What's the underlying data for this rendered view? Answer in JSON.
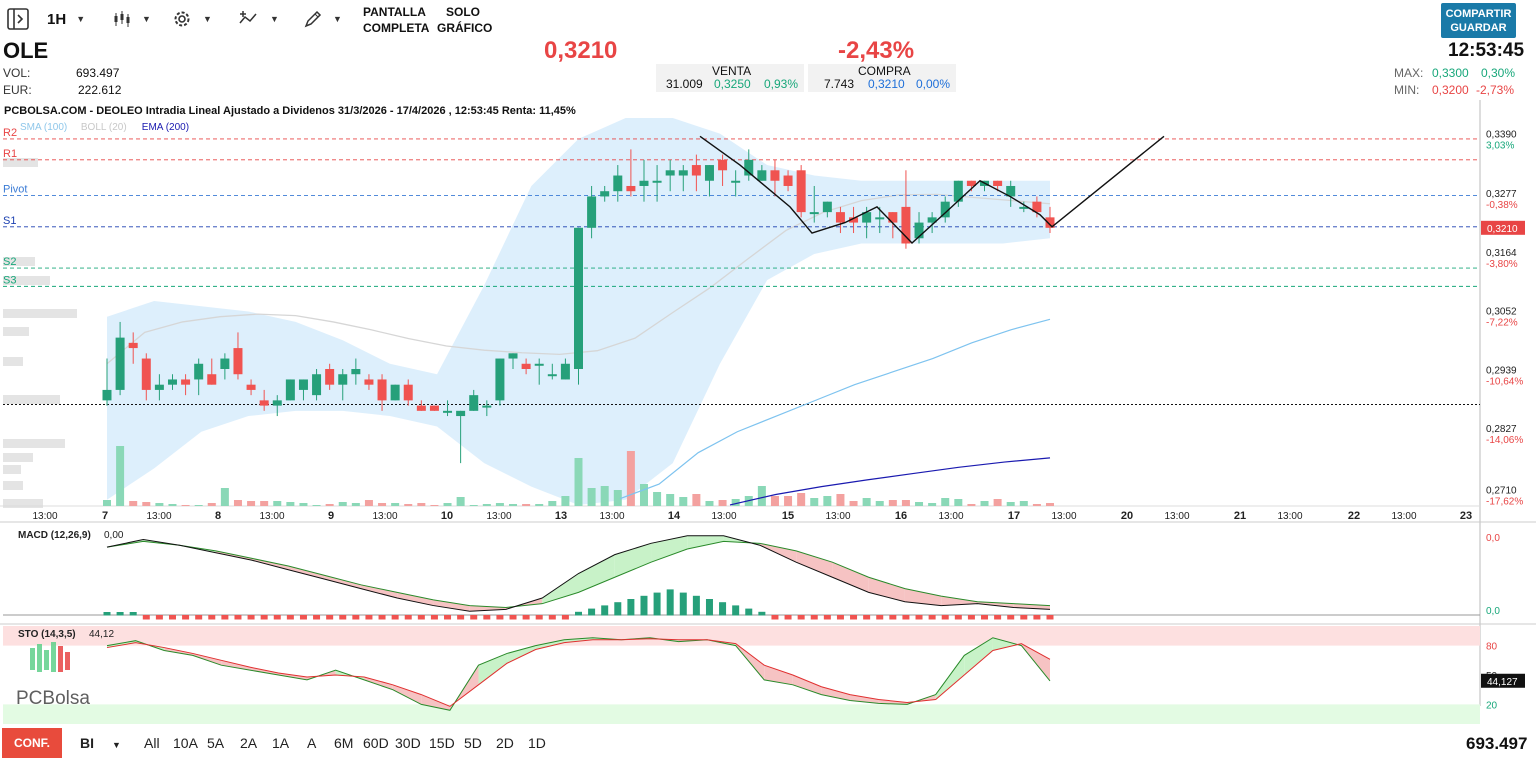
{
  "toolbar": {
    "interval": "1H",
    "fullscreen_line1": "PANTALLA",
    "fullscreen_line2": "COMPLETA",
    "chartonly_line1": "SOLO",
    "chartonly_line2": "GRÁFICO",
    "share_line1": "COMPARTIR",
    "share_line2": "GUARDAR",
    "icons": [
      "panel-toggle-icon",
      "candles-icon",
      "gear-icon",
      "indicators-icon",
      "draw-pencil-icon"
    ]
  },
  "header": {
    "ticker": "OLE",
    "vol_label": "VOL:",
    "vol_value": "693.497",
    "eur_label": "EUR:",
    "eur_value": "222.612",
    "price": "0,3210",
    "change": "-2,43%",
    "time": "12:53:45",
    "sell": {
      "label": "VENTA",
      "qty": "31.009",
      "price": "0,3250",
      "pct": "0,93%"
    },
    "buy": {
      "label": "COMPRA",
      "qty": "7.743",
      "price": "0,3210",
      "pct": "0,00%"
    },
    "max_label": "MAX:",
    "max_price": "0,3300",
    "max_pct": "0,30%",
    "min_label": "MIN:",
    "min_price": "0,3200",
    "min_pct": "-2,73%"
  },
  "colors": {
    "up": "#26a07a",
    "down": "#f05350",
    "accent": "#1a7aa8",
    "price_red": "#e84545"
  },
  "chart_data": [
    {
      "type": "candlestick",
      "title": "PCBOLSA.COM - DEOLEO Intradia Lineal Ajustado a Dividenos 31/3/2026 - 17/4/2026 , 12:53:45 Renta: 11,45%",
      "legend": [
        "SMA (100)",
        "BOLL (20)",
        "EMA (200)"
      ],
      "y_range": [
        0.2678,
        0.342
      ],
      "y_ticks": [
        {
          "value": 0.339,
          "label": "0,3390",
          "pct": "3,03%"
        },
        {
          "value": 0.3277,
          "label": "0,3277",
          "pct": "-0,38%"
        },
        {
          "value": 0.3164,
          "label": "0,3164",
          "pct": "-3,80%"
        },
        {
          "value": 0.3052,
          "label": "0,3052",
          "pct": "-7,22%"
        },
        {
          "value": 0.2939,
          "label": "0,2939",
          "pct": "-10,64%"
        },
        {
          "value": 0.2827,
          "label": "0,2827",
          "pct": "-14,06%"
        },
        {
          "value": 0.271,
          "label": "0,2710",
          "pct": "-17,62%"
        }
      ],
      "last_price": {
        "value": 0.321,
        "label": "0,3210"
      },
      "pivots": [
        {
          "name": "R2",
          "value": 0.338
        },
        {
          "name": "R1",
          "value": 0.334
        },
        {
          "name": "Pivot",
          "value": 0.3272
        },
        {
          "name": "S1",
          "value": 0.3212
        },
        {
          "name": "S2",
          "value": 0.3133
        },
        {
          "name": "S3",
          "value": 0.3098
        }
      ],
      "reference_line": 0.2872,
      "x_ticks": [
        "13:00",
        "7",
        "13:00",
        "8",
        "13:00",
        "9",
        "13:00",
        "10",
        "13:00",
        "13",
        "13:00",
        "14",
        "13:00",
        "15",
        "13:00",
        "16",
        "13:00",
        "17",
        "13:00",
        "20",
        "13:00",
        "21",
        "13:00",
        "22",
        "13:00",
        "23"
      ],
      "candles": [
        [
          0.288,
          0.296,
          0.287,
          0.29
        ],
        [
          0.29,
          0.303,
          0.289,
          0.3
        ],
        [
          0.299,
          0.301,
          0.295,
          0.298
        ],
        [
          0.296,
          0.297,
          0.288,
          0.29
        ],
        [
          0.29,
          0.293,
          0.288,
          0.291
        ],
        [
          0.291,
          0.293,
          0.29,
          0.292
        ],
        [
          0.292,
          0.293,
          0.289,
          0.291
        ],
        [
          0.292,
          0.296,
          0.289,
          0.295
        ],
        [
          0.293,
          0.296,
          0.291,
          0.291
        ],
        [
          0.294,
          0.297,
          0.292,
          0.296
        ],
        [
          0.298,
          0.301,
          0.292,
          0.293
        ],
        [
          0.291,
          0.292,
          0.289,
          0.29
        ],
        [
          0.288,
          0.29,
          0.286,
          0.287
        ],
        [
          0.287,
          0.289,
          0.285,
          0.288
        ],
        [
          0.288,
          0.292,
          0.288,
          0.292
        ],
        [
          0.29,
          0.292,
          0.288,
          0.292
        ],
        [
          0.289,
          0.294,
          0.288,
          0.293
        ],
        [
          0.294,
          0.295,
          0.29,
          0.291
        ],
        [
          0.291,
          0.294,
          0.288,
          0.293
        ],
        [
          0.293,
          0.296,
          0.291,
          0.294
        ],
        [
          0.292,
          0.293,
          0.29,
          0.291
        ],
        [
          0.292,
          0.293,
          0.286,
          0.288
        ],
        [
          0.288,
          0.291,
          0.288,
          0.291
        ],
        [
          0.291,
          0.292,
          0.287,
          0.288
        ],
        [
          0.287,
          0.288,
          0.286,
          0.286
        ],
        [
          0.287,
          0.287,
          0.286,
          0.286
        ],
        [
          0.286,
          0.288,
          0.285,
          0.286
        ],
        [
          0.285,
          0.286,
          0.276,
          0.286
        ],
        [
          0.286,
          0.29,
          0.286,
          0.289
        ],
        [
          0.287,
          0.288,
          0.285,
          0.287
        ],
        [
          0.288,
          0.296,
          0.287,
          0.296
        ],
        [
          0.296,
          0.297,
          0.294,
          0.297
        ],
        [
          0.295,
          0.296,
          0.293,
          0.294
        ],
        [
          0.295,
          0.296,
          0.291,
          0.295
        ],
        [
          0.293,
          0.295,
          0.292,
          0.293
        ],
        [
          0.292,
          0.296,
          0.292,
          0.295
        ],
        [
          0.294,
          0.321,
          0.291,
          0.321
        ],
        [
          0.321,
          0.329,
          0.319,
          0.327
        ],
        [
          0.327,
          0.329,
          0.326,
          0.328
        ],
        [
          0.328,
          0.333,
          0.326,
          0.331
        ],
        [
          0.329,
          0.336,
          0.327,
          0.328
        ],
        [
          0.329,
          0.334,
          0.326,
          0.33
        ],
        [
          0.33,
          0.333,
          0.326,
          0.33
        ],
        [
          0.331,
          0.334,
          0.328,
          0.332
        ],
        [
          0.331,
          0.333,
          0.328,
          0.332
        ],
        [
          0.333,
          0.335,
          0.328,
          0.331
        ],
        [
          0.33,
          0.333,
          0.327,
          0.333
        ],
        [
          0.334,
          0.335,
          0.329,
          0.332
        ],
        [
          0.33,
          0.332,
          0.327,
          0.33
        ],
        [
          0.331,
          0.336,
          0.33,
          0.334
        ],
        [
          0.33,
          0.333,
          0.33,
          0.332
        ],
        [
          0.332,
          0.334,
          0.327,
          0.33
        ],
        [
          0.331,
          0.332,
          0.328,
          0.329
        ],
        [
          0.332,
          0.333,
          0.323,
          0.324
        ],
        [
          0.324,
          0.329,
          0.322,
          0.324
        ],
        [
          0.324,
          0.326,
          0.323,
          0.326
        ],
        [
          0.324,
          0.325,
          0.32,
          0.322
        ],
        [
          0.323,
          0.325,
          0.32,
          0.322
        ],
        [
          0.322,
          0.325,
          0.319,
          0.324
        ],
        [
          0.323,
          0.325,
          0.32,
          0.323
        ],
        [
          0.324,
          0.324,
          0.319,
          0.322
        ],
        [
          0.325,
          0.332,
          0.317,
          0.318
        ],
        [
          0.319,
          0.324,
          0.318,
          0.322
        ],
        [
          0.322,
          0.324,
          0.32,
          0.323
        ],
        [
          0.323,
          0.327,
          0.322,
          0.326
        ],
        [
          0.326,
          0.33,
          0.325,
          0.33
        ],
        [
          0.33,
          0.33,
          0.328,
          0.329
        ],
        [
          0.329,
          0.33,
          0.328,
          0.33
        ],
        [
          0.33,
          0.33,
          0.328,
          0.329
        ],
        [
          0.327,
          0.33,
          0.325,
          0.329
        ],
        [
          0.325,
          0.326,
          0.324,
          0.325
        ],
        [
          0.326,
          0.327,
          0.323,
          0.324
        ],
        [
          0.323,
          0.325,
          0.32,
          0.321
        ]
      ],
      "volumes": [
        0.06,
        0.6,
        0.05,
        0.04,
        0.03,
        0.02,
        0.01,
        0.01,
        0.03,
        0.18,
        0.06,
        0.05,
        0.05,
        0.05,
        0.04,
        0.03,
        0.01,
        0.02,
        0.04,
        0.03,
        0.06,
        0.03,
        0.03,
        0.02,
        0.03,
        0.01,
        0.03,
        0.09,
        0.01,
        0.02,
        0.03,
        0.02,
        0.02,
        0.02,
        0.05,
        0.1,
        0.48,
        0.18,
        0.2,
        0.16,
        0.55,
        0.22,
        0.14,
        0.12,
        0.09,
        0.12,
        0.05,
        0.06,
        0.07,
        0.1,
        0.2,
        0.1,
        0.1,
        0.13,
        0.08,
        0.1,
        0.12,
        0.05,
        0.08,
        0.05,
        0.06,
        0.06,
        0.04,
        0.03,
        0.08,
        0.07,
        0.02,
        0.05,
        0.07,
        0.04,
        0.05,
        0.02,
        0.03
      ],
      "sma_100": [
        0.295,
        0.301,
        0.303,
        0.304,
        0.3045,
        0.3042,
        0.303,
        0.3015,
        0.2998,
        0.2984,
        0.2976,
        0.2971,
        0.2968,
        0.2975,
        0.2999,
        0.3048,
        0.3096,
        0.3151,
        0.3205,
        0.324,
        0.3262,
        0.3273,
        0.3274,
        0.3268,
        0.3262,
        0.3256
      ],
      "ema_200": [
        0.2692,
        0.272,
        0.278,
        0.282,
        0.285,
        0.288,
        0.291,
        0.2935,
        0.296,
        0.299,
        0.3015,
        0.3035
      ],
      "pattern_lines": [
        [
          0.3385,
          0.3349,
          0.3307,
          0.3258,
          0.32,
          0.3214,
          0.323,
          0.3181,
          0.3213,
          0.325,
          0.33,
          0.327,
          0.324,
          0.3214,
          0.33,
          0.3385
        ]
      ],
      "boll_band": {
        "upper": [
          0.304,
          0.307,
          0.306,
          0.305,
          0.303,
          0.2995,
          0.295,
          0.293,
          0.31,
          0.329,
          0.338,
          0.342,
          0.342,
          0.339,
          0.333,
          0.331,
          0.33,
          0.33,
          0.33,
          0.33,
          0.33
        ],
        "lower": [
          0.269,
          0.275,
          0.282,
          0.285,
          0.286,
          0.286,
          0.285,
          0.283,
          0.276,
          0.2715,
          0.268,
          0.269,
          0.276,
          0.295,
          0.311,
          0.316,
          0.318,
          0.318,
          0.318,
          0.318,
          0.319
        ]
      }
    },
    {
      "type": "line",
      "title": "MACD (12,26,9)",
      "value_label": "0,00",
      "y_ticks": [
        {
          "label": "0,0",
          "pos": "top"
        },
        {
          "label": "0,0",
          "pos": "bottom"
        }
      ],
      "macd": [
        0.0032,
        0.0036,
        0.0033,
        0.0029,
        0.0025,
        0.002,
        0.0015,
        0.001,
        0.0005,
        0.0001,
        -0.0002,
        -0.0001,
        0.0005,
        0.0018,
        0.0028,
        0.0034,
        0.0038,
        0.0038,
        0.0033,
        0.0024,
        0.0016,
        0.0008,
        0.0003,
        0.0001,
        0.0002,
        0.0,
        -0.0001
      ],
      "signal": [
        0.0032,
        0.0035,
        0.0033,
        0.003,
        0.0026,
        0.0022,
        0.0017,
        0.0012,
        0.0008,
        0.0004,
        0.0001,
        0.0,
        0.0002,
        0.0008,
        0.0016,
        0.0024,
        0.0031,
        0.0035,
        0.0034,
        0.003,
        0.0024,
        0.0016,
        0.001,
        0.0006,
        0.0003,
        0.0002,
        0.0001
      ]
    },
    {
      "type": "line",
      "title": "STO (14,3,5)",
      "value_label": "44,12",
      "last_label": "44,127",
      "y_ticks": [
        "80",
        "50",
        "20"
      ],
      "y_range": [
        0,
        100
      ],
      "k": [
        80,
        85,
        75,
        70,
        60,
        55,
        50,
        45,
        55,
        45,
        35,
        20,
        14,
        60,
        72,
        80,
        86,
        88,
        86,
        88,
        84,
        86,
        80,
        45,
        40,
        30,
        24,
        21,
        20,
        30,
        70,
        88,
        80,
        44
      ],
      "d": [
        78,
        83,
        78,
        72,
        65,
        58,
        52,
        48,
        50,
        48,
        40,
        30,
        18,
        40,
        62,
        76,
        83,
        86,
        86,
        87,
        86,
        86,
        82,
        60,
        50,
        38,
        30,
        25,
        22,
        25,
        50,
        75,
        82,
        66
      ]
    }
  ],
  "watermark": "PCBolsa",
  "bottombar": {
    "config_label": "CONF.",
    "mode_label": "BI",
    "ranges": [
      "All",
      "10A",
      "5A",
      "2A",
      "1A",
      "A",
      "6M",
      "60D",
      "30D",
      "15D",
      "5D",
      "2D",
      "1D"
    ],
    "total_volume": "693.497"
  }
}
